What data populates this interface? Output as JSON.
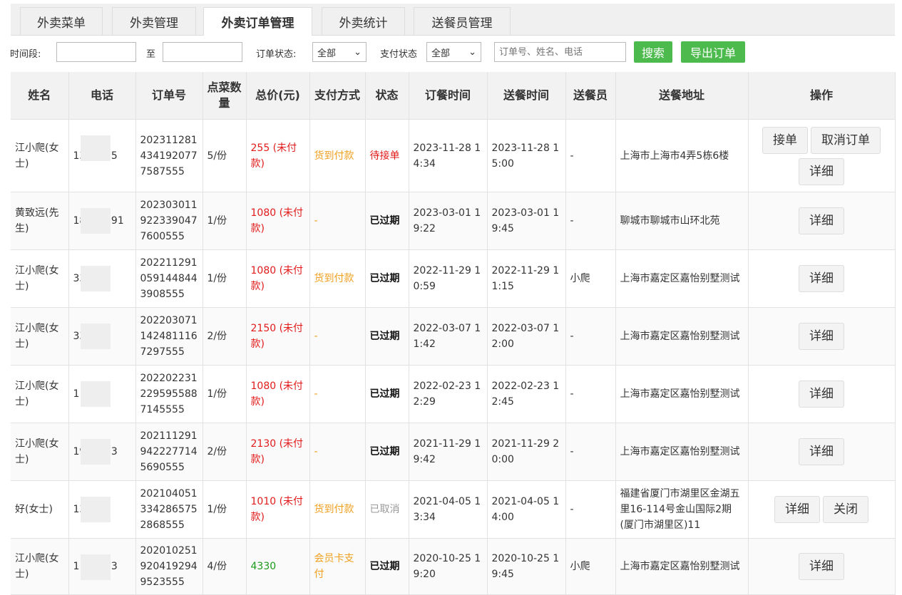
{
  "tabs": [
    "外卖菜单",
    "外卖管理",
    "外卖订单管理",
    "外卖统计",
    "送餐员管理"
  ],
  "filters": {
    "time_label": "时间段:",
    "to_label": "至",
    "start_value": "",
    "end_value": "",
    "order_status_label": "订单状态:",
    "order_status_value": "全部",
    "pay_status_label": "支付状态",
    "pay_status_value": "全部",
    "search_placeholder": "订单号、姓名、电话",
    "search_button": "搜索",
    "export_button": "导出订单"
  },
  "table": {
    "headers": [
      "姓名",
      "电话",
      "订单号",
      "点菜数量",
      "总价(元)",
      "支付方式",
      "状态",
      "订餐时间",
      "送餐时间",
      "送餐员",
      "送餐地址",
      "操作"
    ],
    "rows": [
      {
        "name": "江小爬(女士)",
        "phone": "13 96 15",
        "order_no": "2023112814341920777587555",
        "qty": "5/份",
        "total": "255 (未付款)",
        "pay": "货到付款",
        "status": "待接单",
        "order_time": "2023-11-28 14:34",
        "deliver_time": "2023-11-28 15:00",
        "courier": "-",
        "address": "上海市上海市4弄5栋6楼",
        "ops": [
          "接单",
          "取消订单",
          "详细"
        ]
      },
      {
        "name": "黄致远(先生)",
        "phone": "18 668 91",
        "order_no": "2023030119223390477600555",
        "qty": "1/份",
        "total": "1080 (未付款)",
        "pay": "-",
        "status": "已过期",
        "order_time": "2023-03-01 19:22",
        "deliver_time": "2023-03-01 19:45",
        "courier": "-",
        "address": "聊城市聊城市山环北苑",
        "ops": [
          "详细"
        ]
      },
      {
        "name": "江小爬(女士)",
        "phone": "333",
        "order_no": "2022112910591448443908555",
        "qty": "1/份",
        "total": "1080 (未付款)",
        "pay": "货到付款",
        "status": "已过期",
        "order_time": "2022-11-29 10:59",
        "deliver_time": "2022-11-29 11:15",
        "courier": "小爬",
        "address": "上海市嘉定区嘉怡别墅测试",
        "ops": [
          "详细"
        ]
      },
      {
        "name": "江小爬(女士)",
        "phone": "333 3",
        "order_no": "2022030711424811167297555",
        "qty": "2/份",
        "total": "2150 (未付款)",
        "pay": "-",
        "status": "已过期",
        "order_time": "2022-03-07 11:42",
        "deliver_time": "2022-03-07 12:00",
        "courier": "-",
        "address": "上海市嘉定区嘉怡别墅测试",
        "ops": [
          "详细"
        ]
      },
      {
        "name": "江小爬(女士)",
        "phone": "1 333 3",
        "order_no": "2022022312295955887145555",
        "qty": "1/份",
        "total": "1080 (未付款)",
        "pay": "-",
        "status": "已过期",
        "order_time": "2022-02-23 12:29",
        "deliver_time": "2022-02-23 12:45",
        "courier": "-",
        "address": "上海市嘉定区嘉怡别墅测试",
        "ops": [
          "详细"
        ]
      },
      {
        "name": "江小爬(女士)",
        "phone": "19 33 33",
        "order_no": "2021112919422277145690555",
        "qty": "2/份",
        "total": "2130 (未付款)",
        "pay": "-",
        "status": "已过期",
        "order_time": "2021-11-29 19:42",
        "deliver_time": "2021-11-29 20:00",
        "courier": "-",
        "address": "上海市嘉定区嘉怡别墅测试",
        "ops": [
          "详细"
        ]
      },
      {
        "name": "好(女士)",
        "phone": "13 33 3",
        "order_no": "2021040513342865752868555",
        "qty": "1/份",
        "total": "1010 (未付款)",
        "pay": "货到付款",
        "status": "已取消",
        "order_time": "2021-04-05 13:34",
        "deliver_time": "2021-04-05 14:00",
        "courier": "-",
        "address": "福建省厦门市湖里区金湖五里16-114号金山国际2期(厦门市湖里区)11",
        "ops": [
          "详细",
          "关闭"
        ]
      },
      {
        "name": "江小爬(女士)",
        "phone": "1 3333 3",
        "order_no": "2020102519204192949523555",
        "qty": "4/份",
        "total": "4330",
        "pay": "会员卡支付",
        "status": "已过期",
        "order_time": "2020-10-25 19:20",
        "deliver_time": "2020-10-25 19:45",
        "courier": "小爬",
        "address": "上海市嘉定区嘉怡别墅测试",
        "ops": [
          "详细"
        ]
      }
    ]
  },
  "colors": {
    "unpaid": "#e21a1a",
    "paid": "#1a9a1a",
    "pay_method": "#f0a020",
    "pending": "#e21a1a",
    "cancelled": "#999999",
    "button_green": "#4cba4c"
  }
}
